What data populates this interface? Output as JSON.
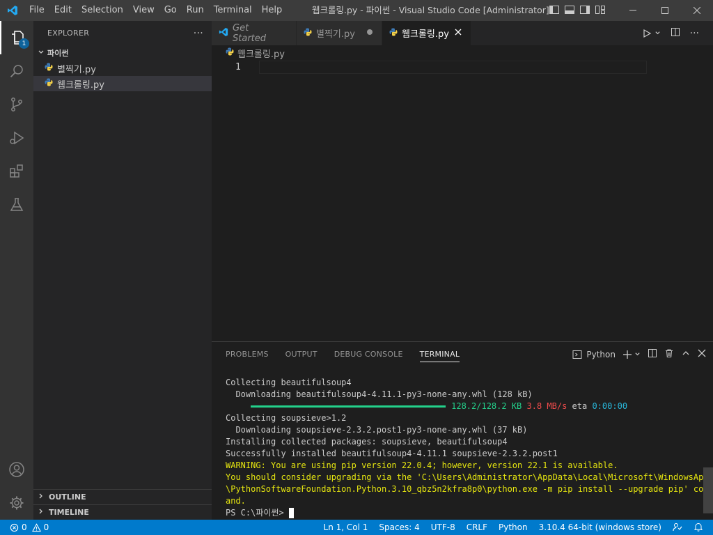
{
  "window": {
    "title": "웹크롤링.py - 파이썬 - Visual Studio Code [Administrator]"
  },
  "menu": [
    "File",
    "Edit",
    "Selection",
    "View",
    "Go",
    "Run",
    "Terminal",
    "Help"
  ],
  "activity": {
    "explorer_badge": "1"
  },
  "sidebar": {
    "header": "EXPLORER",
    "more": "···",
    "folder": "파이썬",
    "files": [
      "별찍기.py",
      "웹크롤링.py"
    ],
    "outline": "OUTLINE",
    "timeline": "TIMELINE"
  },
  "tabs": [
    {
      "label": "Get Started"
    },
    {
      "label": "별찍기.py"
    },
    {
      "label": "웹크롤링.py"
    }
  ],
  "breadcrumb": "웹크롤링.py",
  "editor": {
    "line_number": "1"
  },
  "panel": {
    "tabs": [
      "PROBLEMS",
      "OUTPUT",
      "DEBUG CONSOLE",
      "TERMINAL"
    ],
    "terminal_name": "Python"
  },
  "terminal": {
    "l1": "Collecting beautifulsoup4",
    "l2": "  Downloading beautifulsoup4-4.11.1-py3-none-any.whl (128 kB)",
    "l3_size": "128.2/128.2 KB",
    "l3_speed": "3.8 MB/s",
    "l3_eta_label": "eta",
    "l3_eta": "0:00:00",
    "l4": "Collecting soupsieve>1.2",
    "l5": "  Downloading soupsieve-2.3.2.post1-py3-none-any.whl (37 kB)",
    "l6": "Installing collected packages: soupsieve, beautifulsoup4",
    "l7": "Successfully installed beautifulsoup4-4.11.1 soupsieve-2.3.2.post1",
    "l8": "WARNING: You are using pip version 22.0.4; however, version 22.1 is available.",
    "l9": "You should consider upgrading via the 'C:\\Users\\Administrator\\AppData\\Local\\Microsoft\\WindowsApps",
    "l10": "\\PythonSoftwareFoundation.Python.3.10_qbz5n2kfra8p0\\python.exe -m pip install --upgrade pip' comm",
    "l11": "and.",
    "prompt": "PS C:\\파이썬> "
  },
  "status": {
    "errors": "0",
    "warnings": "0",
    "position": "Ln 1, Col 1",
    "spaces": "Spaces: 4",
    "encoding": "UTF-8",
    "eol": "CRLF",
    "language": "Python",
    "interpreter": "3.10.4 64-bit (windows store)"
  },
  "colors": {
    "accent": "#007acc",
    "vscode_blue": "#23a9f2",
    "python_blue": "#3e7ab5",
    "python_yellow": "#f5d24a"
  }
}
